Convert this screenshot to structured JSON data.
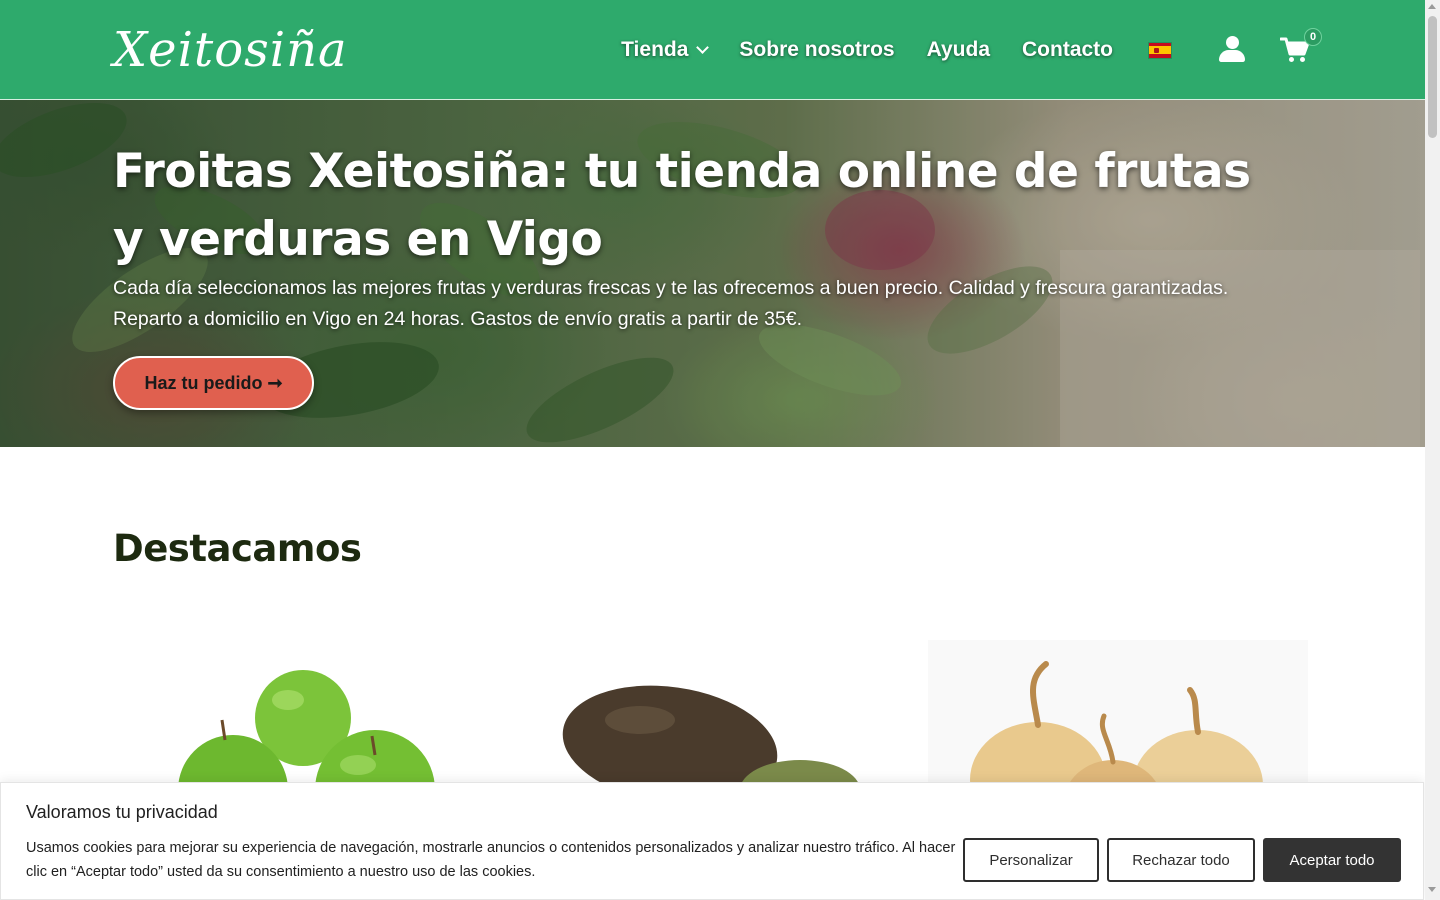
{
  "header": {
    "logo_text": "Xeitosiña",
    "nav": {
      "shop": "Tienda",
      "about": "Sobre nosotros",
      "help": "Ayuda",
      "contact": "Contacto"
    },
    "language_flag": "es-flag-icon",
    "user_icon": "user-icon",
    "cart_icon": "cart-icon",
    "cart_count": "0",
    "colors": {
      "header_bg": "#2eaa6c"
    }
  },
  "hero": {
    "title": "Froitas Xeitosiña: tu tienda online de frutas y verduras en Vigo",
    "text_line1": "Cada día seleccionamos las mejores frutas y verduras frescas y te las ofrecemos a buen precio. Calidad y frescura garantizadas.",
    "text_line2": "Reparto a domicilio en Vigo en 24 horas. Gastos de envío gratis a partir de 35€.",
    "cta": "Haz tu pedido ➞",
    "colors": {
      "cta_bg": "#e0604f"
    }
  },
  "featured": {
    "title": "Destacamos",
    "products": [
      {
        "image": "green-apples"
      },
      {
        "image": "avocados"
      },
      {
        "image": "onions"
      }
    ]
  },
  "cookie_banner": {
    "title": "Valoramos tu privacidad",
    "text": "Usamos cookies para mejorar su experiencia de navegación, mostrarle anuncios o contenidos personalizados y analizar nuestro tráfico. Al hacer clic en “Aceptar todo” usted da su consentimiento a nuestro uso de las cookies.",
    "customize": "Personalizar",
    "reject": "Rechazar todo",
    "accept": "Aceptar todo"
  }
}
